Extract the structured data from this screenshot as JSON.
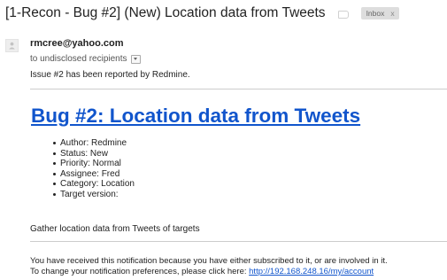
{
  "email": {
    "subject": "[1-Recon - Bug #2] (New) Location data from Tweets",
    "label_chip": {
      "text": "Inbox",
      "close": "x"
    },
    "sender": "rmcree@yahoo.com",
    "recipients": "to undisclosed recipients",
    "intro": "Issue #2 has been reported by Redmine."
  },
  "issue": {
    "title": "Bug #2: Location data from Tweets",
    "details": [
      "Author: Redmine",
      "Status: New",
      "Priority: Normal",
      "Assignee: Fred",
      "Category: Location",
      "Target version:"
    ],
    "description": "Gather location data from Tweets of targets"
  },
  "footer": {
    "line1": "You have received this notification because you have either subscribed to it, or are involved in it.",
    "line2_prefix": "To change your notification preferences, please click here: ",
    "link": "http://192.168.248.16/my/account"
  },
  "icons": {
    "avatar": "person-silhouette-icon",
    "label": "label-tag-icon",
    "caret": "chevron-down-icon"
  },
  "colors": {
    "link": "#1155cc",
    "chip_bg": "#dddddd"
  }
}
